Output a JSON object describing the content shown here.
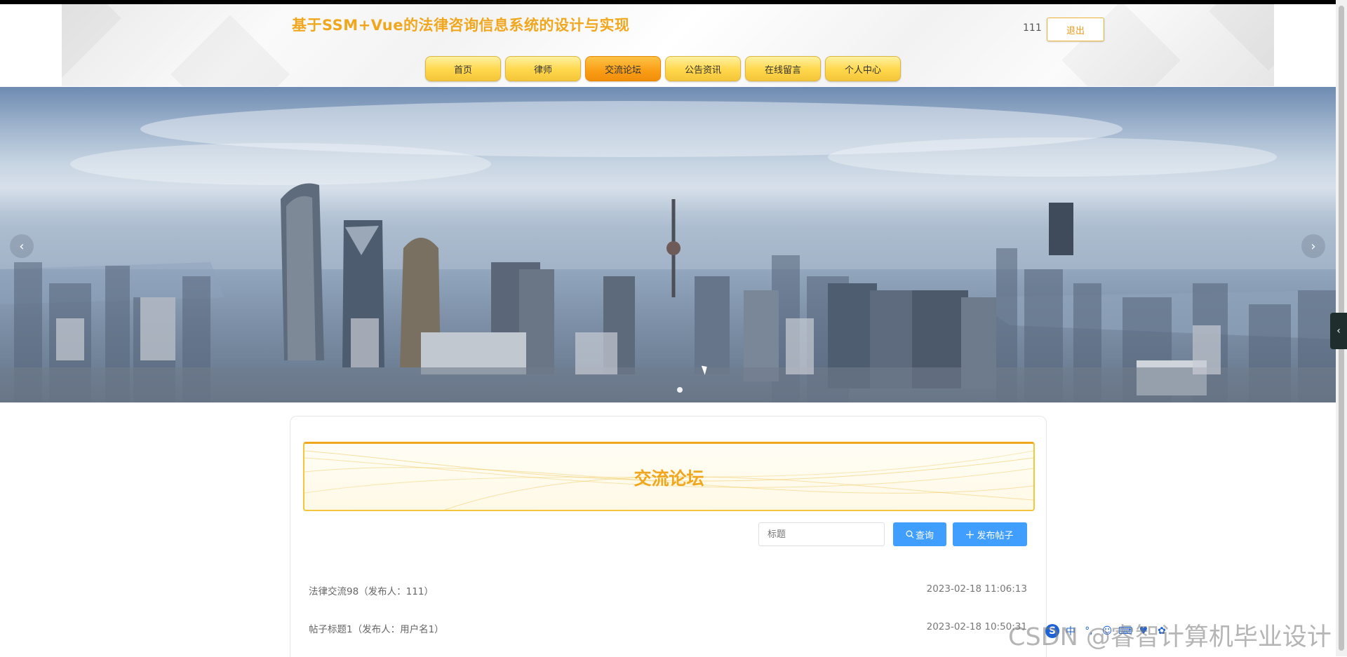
{
  "header": {
    "site_title": "基于SSM+Vue的法律咨询信息系统的设计与实现",
    "user_name": "111",
    "logout_label": "退出"
  },
  "nav": {
    "items": [
      {
        "label": "首页"
      },
      {
        "label": "律师"
      },
      {
        "label": "交流论坛"
      },
      {
        "label": "公告资讯"
      },
      {
        "label": "在线留言"
      },
      {
        "label": "个人中心"
      }
    ],
    "active": "交流论坛"
  },
  "carousel": {
    "prev_icon": "‹",
    "next_icon": "›"
  },
  "forum": {
    "section_title": "交流论坛",
    "search_placeholder": "标题",
    "query_label": "查询",
    "post_label": "发布帖子",
    "posts": [
      {
        "title": "法律交流98（发布人：111）",
        "time": "2023-02-18 11:06:13"
      },
      {
        "title": "帖子标题1（发布人：用户名1）",
        "time": "2023-02-18 10:50:31"
      }
    ]
  },
  "overlay": {
    "watermark": "CSDN @睿智计算机毕业设计",
    "ime_logo": "S",
    "ime_items": [
      "中",
      "°,",
      "☺",
      "⌨",
      "♥",
      "✿"
    ]
  },
  "colors": {
    "accent_orange": "#f0a71e",
    "nav_yellow": "#ffd74a",
    "nav_active": "#f99d14",
    "button_blue": "#409eff"
  }
}
